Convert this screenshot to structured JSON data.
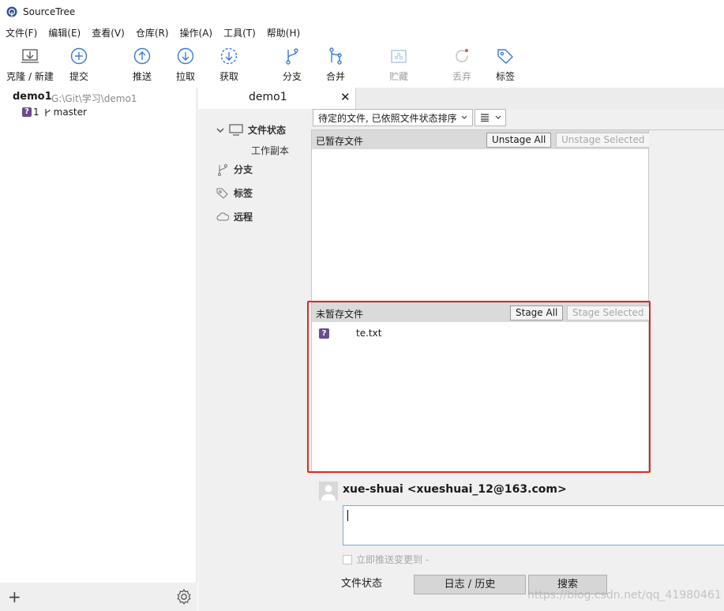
{
  "app": {
    "title": "SourceTree"
  },
  "menu": [
    "文件(F)",
    "编辑(E)",
    "查看(V)",
    "仓库(R)",
    "操作(A)",
    "工具(T)",
    "帮助(H)"
  ],
  "toolbar": {
    "clone": "克隆 / 新建",
    "commit": "提交",
    "push": "推送",
    "pull": "拉取",
    "fetch": "获取",
    "branch": "分支",
    "merge": "合并",
    "stash": "贮藏",
    "discard": "丢弃",
    "tag": "标签"
  },
  "repo": {
    "name": "demo1",
    "path": "G:\\Git\\学习\\demo1",
    "untracked_count": "1",
    "branch": "master"
  },
  "tab": {
    "title": "demo1"
  },
  "nav": {
    "file_status": "文件状态",
    "working_copy": "工作副本",
    "branches": "分支",
    "tags": "标签",
    "remotes": "远程"
  },
  "filter": {
    "selected": "待定的文件, 已依照文件状态排序"
  },
  "staged": {
    "title": "已暂存文件",
    "unstage_all": "Unstage All",
    "unstage_selected": "Unstage Selected"
  },
  "unstaged": {
    "title": "未暂存文件",
    "stage_all": "Stage All",
    "stage_selected": "Stage Selected",
    "files": [
      {
        "name": "te.txt",
        "status": "?"
      }
    ]
  },
  "commit": {
    "author": "xue-shuai <xueshuai_12@163.com>",
    "push_label": "立即推送变更到 -"
  },
  "bottom_tabs": [
    "文件状态",
    "日志 / 历史",
    "搜索"
  ],
  "watermark": "https://blog.csdn.net/qq_41980461",
  "colors": {
    "highlight": "#e0271f",
    "untracked_badge": "#6a4c8c",
    "toolbar_icon": "#3a7bd5"
  }
}
